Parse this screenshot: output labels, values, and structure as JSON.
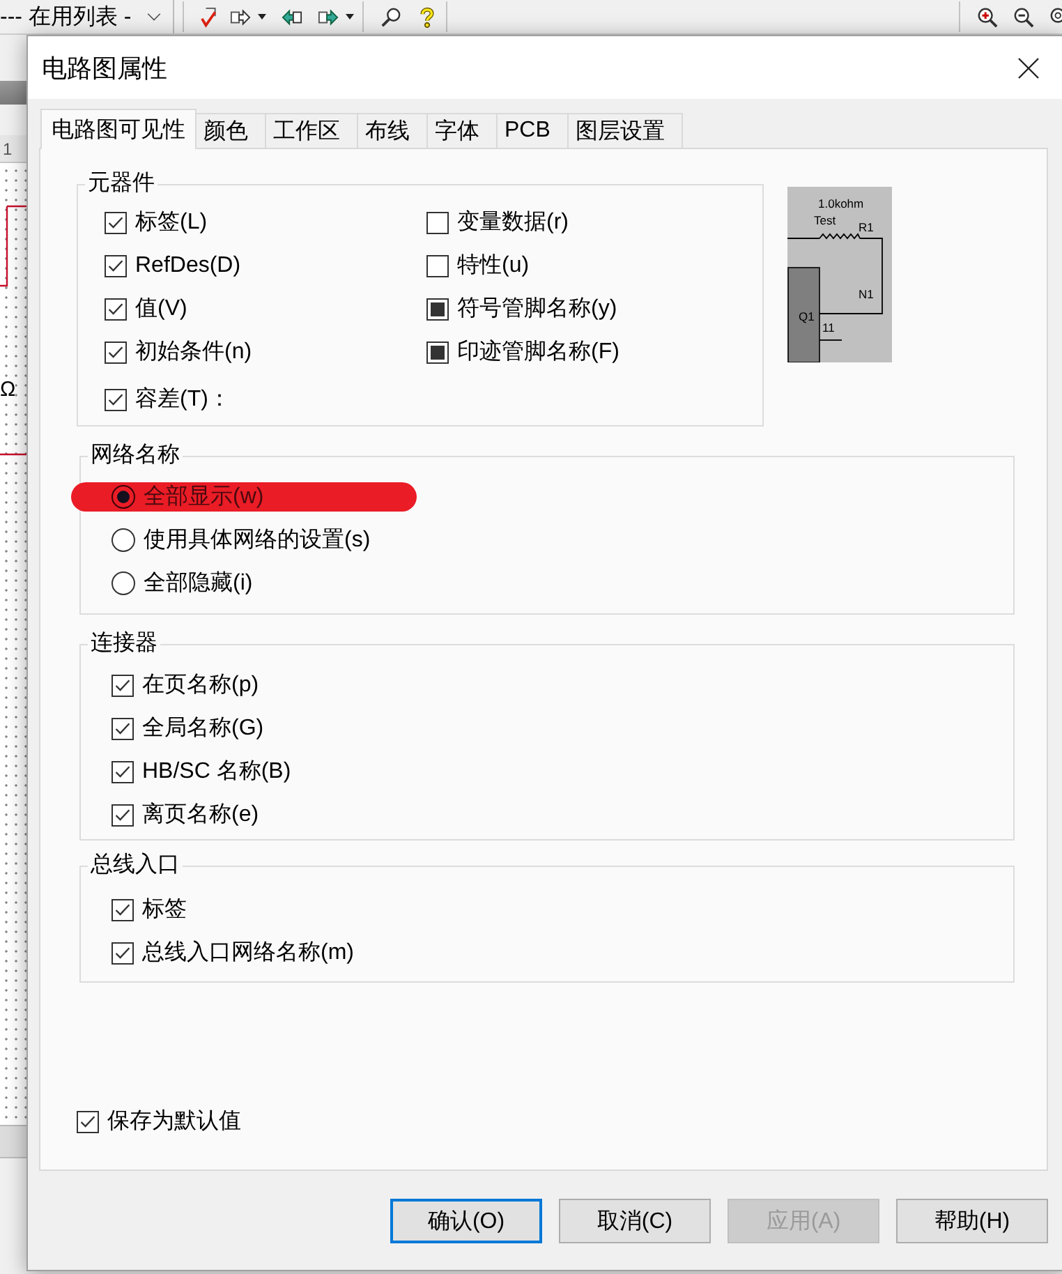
{
  "app": {
    "list_dropdown": "--- 在用列表 -",
    "ruler_mark": "1",
    "canvas_symbol": "Ω"
  },
  "dialog": {
    "title": "电路图属性"
  },
  "tabs": [
    {
      "label": "电路图可见性",
      "selected": true
    },
    {
      "label": "颜色",
      "selected": false
    },
    {
      "label": "工作区",
      "selected": false
    },
    {
      "label": "布线",
      "selected": false
    },
    {
      "label": "字体",
      "selected": false
    },
    {
      "label": "PCB",
      "selected": false
    },
    {
      "label": "图层设置",
      "selected": false
    }
  ],
  "components": {
    "title": "元器件",
    "columns": [
      {
        "options": [
          {
            "label": "标签(L)",
            "checked": true,
            "indeterminate": false
          },
          {
            "label": "RefDes(D)",
            "checked": true,
            "indeterminate": false
          },
          {
            "label": "值(V)",
            "checked": true,
            "indeterminate": false
          },
          {
            "label": "初始条件(n)",
            "checked": true,
            "indeterminate": false
          },
          {
            "label": "容差(T)：",
            "checked": true,
            "indeterminate": false
          }
        ]
      },
      {
        "options": [
          {
            "label": "变量数据(r)",
            "checked": false,
            "indeterminate": false
          },
          {
            "label": "特性(u)",
            "checked": false,
            "indeterminate": false
          },
          {
            "label": "符号管脚名称(y)",
            "checked": false,
            "indeterminate": true
          },
          {
            "label": "印迹管脚名称(F)",
            "checked": false,
            "indeterminate": true
          }
        ]
      }
    ]
  },
  "preview": {
    "value": "1.0kohm",
    "label": "Test",
    "refdes": "R1",
    "net": "N1",
    "part": "Q1",
    "pin": "11"
  },
  "net_names": {
    "title": "网络名称",
    "options": [
      {
        "label": "全部显示(w)",
        "selected": true,
        "highlighted": true
      },
      {
        "label": "使用具体网络的设置(s)",
        "selected": false,
        "highlighted": false
      },
      {
        "label": "全部隐藏(i)",
        "selected": false,
        "highlighted": false
      }
    ]
  },
  "connectors": {
    "title": "连接器",
    "options": [
      {
        "label": "在页名称(p)",
        "checked": true
      },
      {
        "label": "全局名称(G)",
        "checked": true
      },
      {
        "label": "HB/SC 名称(B)",
        "checked": true
      },
      {
        "label": "离页名称(e)",
        "checked": true
      }
    ]
  },
  "bus_entry": {
    "title": "总线入口",
    "options": [
      {
        "label": "标签",
        "checked": true
      },
      {
        "label": "总线入口网络名称(m)",
        "checked": true
      }
    ]
  },
  "save_default": {
    "label": "保存为默认值",
    "checked": true
  },
  "buttons": [
    {
      "label": "确认(O)",
      "focused": true,
      "disabled": false
    },
    {
      "label": "取消(C)",
      "focused": false,
      "disabled": false
    },
    {
      "label": "应用(A)",
      "focused": false,
      "disabled": true
    },
    {
      "label": "帮助(H)",
      "focused": false,
      "disabled": false
    }
  ]
}
